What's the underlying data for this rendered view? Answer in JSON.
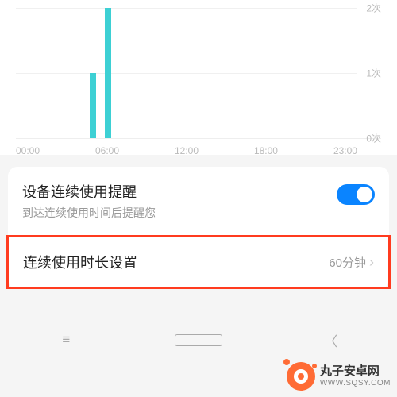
{
  "chart_data": {
    "type": "bar",
    "title": "",
    "xlabel": "",
    "ylabel": "",
    "x_ticks": [
      "00:00",
      "06:00",
      "12:00",
      "18:00",
      "23:00"
    ],
    "y_ticks": [
      "2次",
      "1次",
      "0次"
    ],
    "ylim": [
      0,
      2
    ],
    "categories_hours": [
      5,
      6
    ],
    "values": [
      1,
      2
    ],
    "bar_color": "#3dd0d4"
  },
  "settings": {
    "reminder_title": "设备连续使用提醒",
    "reminder_sub": "到达连续使用时间后提醒您",
    "reminder_on": true,
    "duration_title": "连续使用时长设置",
    "duration_value": "60分钟"
  },
  "watermark": {
    "line1": "丸子安卓网",
    "line2": "WWW.SQSY.COM"
  }
}
